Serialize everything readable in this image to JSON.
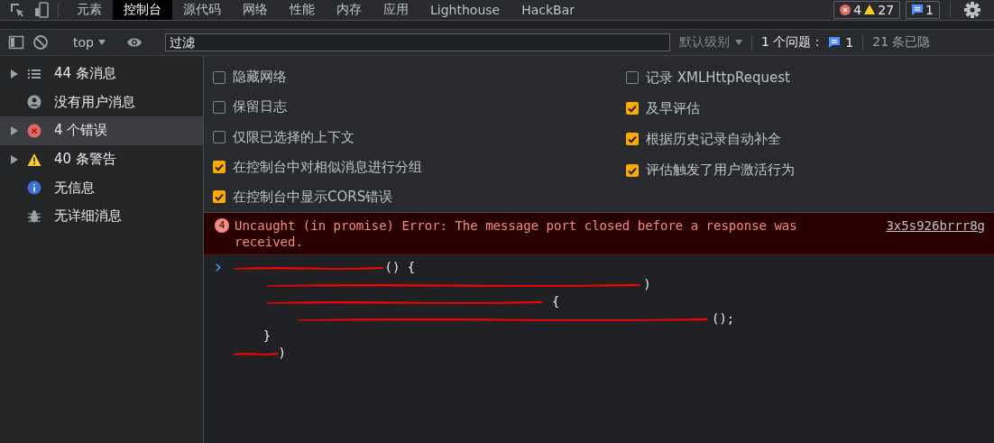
{
  "tabs": [
    {
      "label": "元素",
      "selected": false
    },
    {
      "label": "控制台",
      "selected": true
    },
    {
      "label": "源代码",
      "selected": false
    },
    {
      "label": "网络",
      "selected": false
    },
    {
      "label": "性能",
      "selected": false
    },
    {
      "label": "内存",
      "selected": false
    },
    {
      "label": "应用",
      "selected": false
    },
    {
      "label": "Lighthouse",
      "selected": false
    },
    {
      "label": "HackBar",
      "selected": false
    }
  ],
  "counters": {
    "errors": "4",
    "warnings": "27",
    "issues": "1"
  },
  "toolbar": {
    "context": "top",
    "filter_placeholder": "过滤",
    "level": "默认级别",
    "issues_label": "1 个问题：",
    "issues_count": "1",
    "hidden": "21 条已隐"
  },
  "sidebar": {
    "items": [
      {
        "label": "44 条消息",
        "kind": "all",
        "expandable": true,
        "selected": false
      },
      {
        "label": "没有用户消息",
        "kind": "user",
        "expandable": false,
        "selected": false
      },
      {
        "label": "4 个错误",
        "kind": "error",
        "expandable": true,
        "selected": true
      },
      {
        "label": "40 条警告",
        "kind": "warning",
        "expandable": true,
        "selected": false
      },
      {
        "label": "无信息",
        "kind": "info",
        "expandable": false,
        "selected": false
      },
      {
        "label": "无详细消息",
        "kind": "verbose",
        "expandable": false,
        "selected": false
      }
    ]
  },
  "settings": {
    "left": [
      {
        "label": "隐藏网络",
        "checked": false
      },
      {
        "label": "保留日志",
        "checked": false
      },
      {
        "label": "仅限已选择的上下文",
        "checked": false
      },
      {
        "label": "在控制台中对相似消息进行分组",
        "checked": true
      },
      {
        "label": "在控制台中显示CORS错误",
        "checked": true
      }
    ],
    "right": [
      {
        "label": "记录 XMLHttpRequest",
        "checked": false
      },
      {
        "label": "及早评估",
        "checked": true
      },
      {
        "label": "根据历史记录自动补全",
        "checked": true
      },
      {
        "label": "评估触发了用户激活行为",
        "checked": true
      }
    ]
  },
  "error": {
    "count": "4",
    "message": "Uncaught (in promise) Error: The message port closed before a response was received.",
    "source": "3x5s926brrr8g"
  },
  "code": [
    [
      {
        "kind": "scribble"
      },
      {
        "text": "() {",
        "kind": "plain"
      }
    ],
    [
      {
        "kind": "scribble"
      },
      {
        "text": ")",
        "kind": "plain"
      }
    ],
    [
      {
        "kind": "scribble"
      },
      {
        "text": " {",
        "kind": "plain"
      }
    ],
    [
      {
        "kind": "scribble"
      },
      {
        "text": "();",
        "kind": "plain"
      }
    ],
    [
      {
        "text": "}",
        "kind": "plain"
      }
    ],
    [
      {
        "kind": "scribble"
      },
      {
        "text": ")",
        "kind": "plain"
      }
    ]
  ]
}
